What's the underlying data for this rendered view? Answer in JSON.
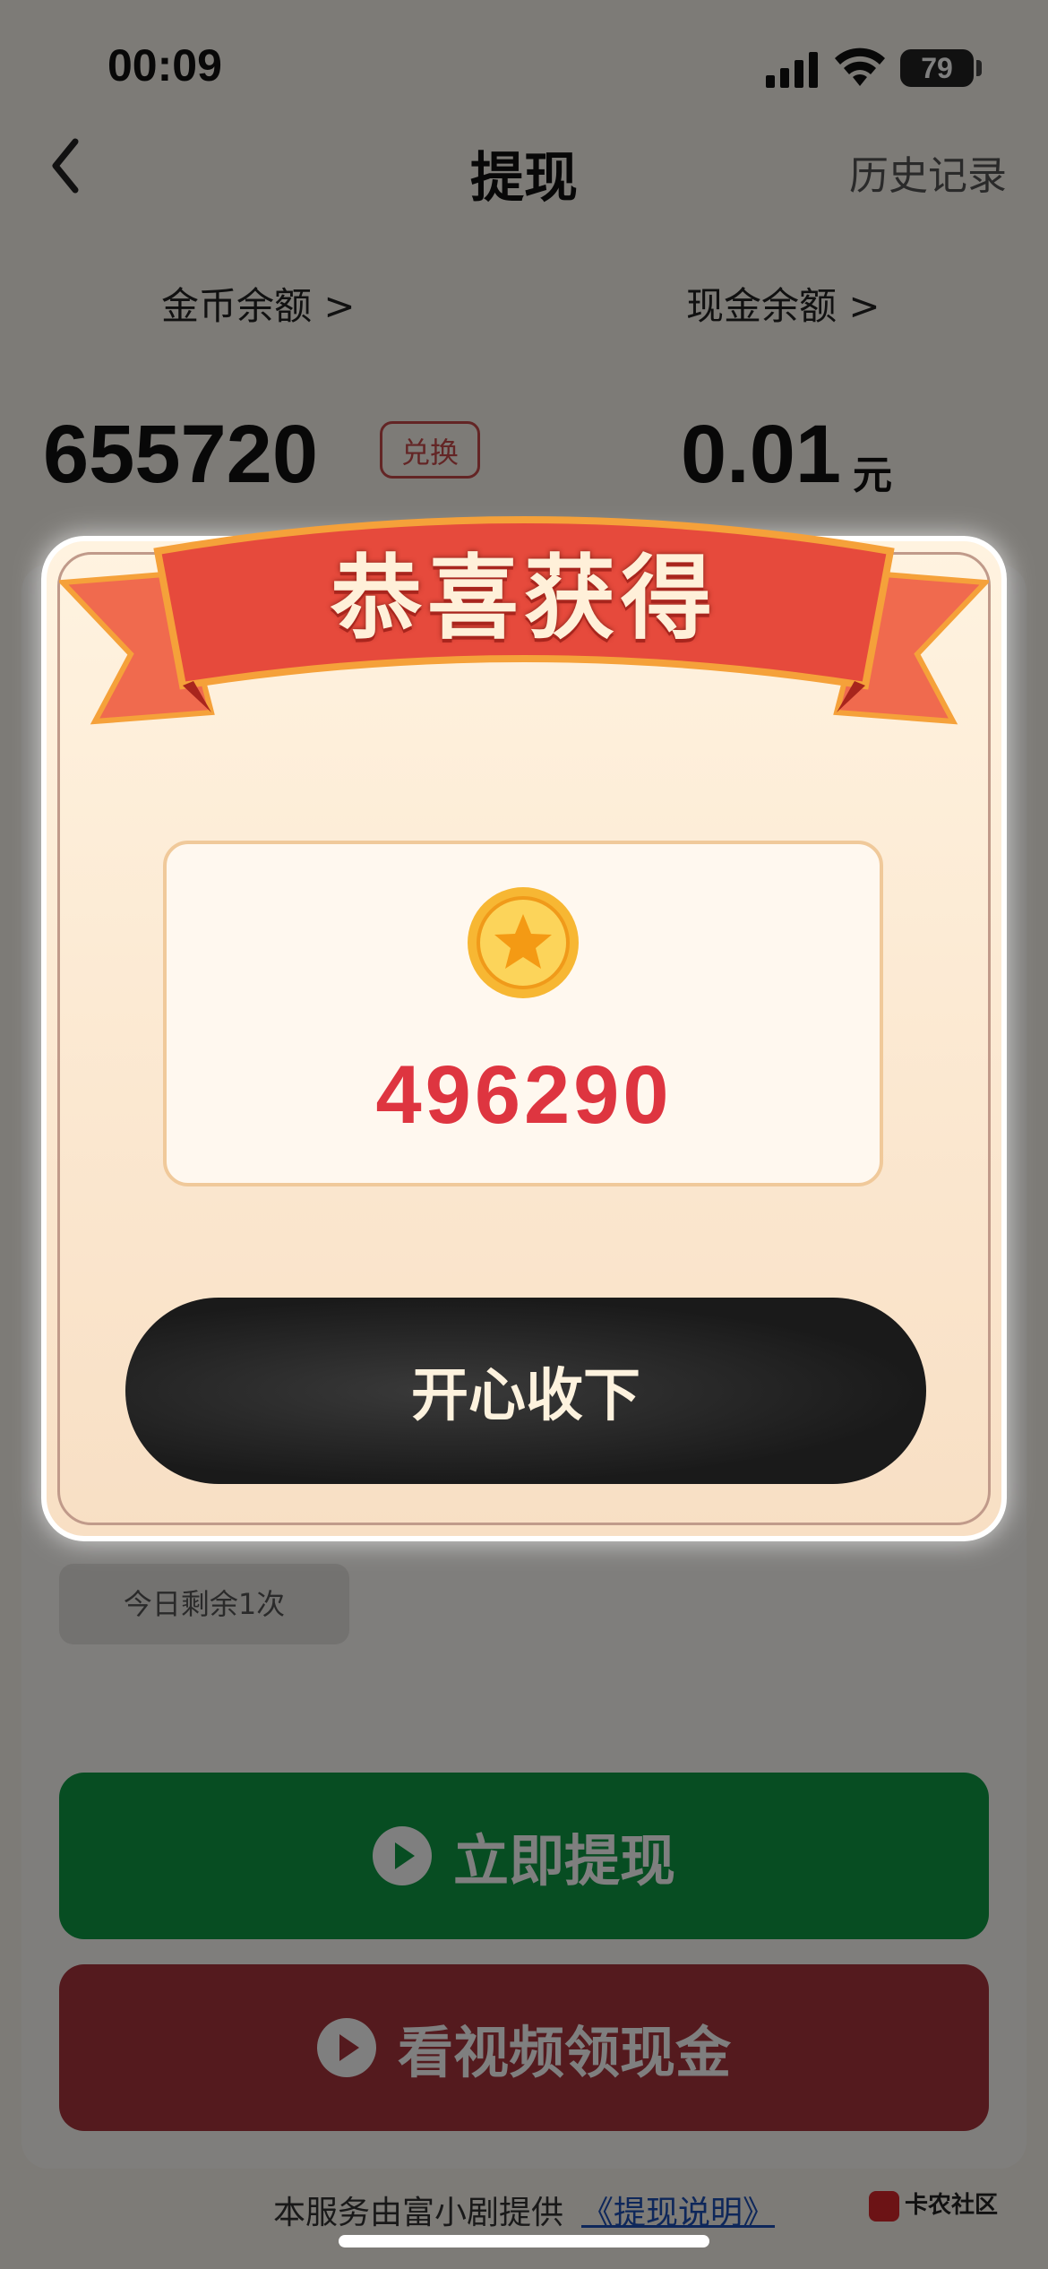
{
  "status_bar": {
    "time": "00:09",
    "battery": "79"
  },
  "nav": {
    "title": "提现",
    "history": "历史记录"
  },
  "balances": {
    "coin_label": "金币余额 >",
    "cash_label": "现金余额 >",
    "coins": "655720",
    "exchange": "兑换",
    "cash": "0.01",
    "cash_unit": "元"
  },
  "remaining": "今日剩余1次",
  "buttons": {
    "withdraw": "立即提现",
    "watch_video": "看视频领现金"
  },
  "footer": {
    "text": "本服务由富小剧提供",
    "link": "《提现说明》"
  },
  "watermark": "卡农社区",
  "modal": {
    "title": "恭喜获得",
    "amount": "496290",
    "accept": "开心收下"
  },
  "colors": {
    "green": "#0e9a44",
    "red": "#a8343c",
    "prize": "#de3540"
  },
  "icons": [
    "back-chevron-icon",
    "signal-icon",
    "wifi-icon",
    "battery-icon",
    "coin-star-icon",
    "play-icon"
  ]
}
